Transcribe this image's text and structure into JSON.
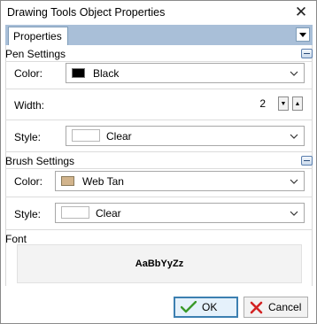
{
  "window": {
    "title": "Drawing Tools Object Properties"
  },
  "tabs": [
    {
      "label": "Properties"
    }
  ],
  "pen": {
    "header": "Pen Settings",
    "color_label": "Color:",
    "color_value": "Black",
    "color_swatch": "#000000",
    "width_label": "Width:",
    "width_value": "2",
    "style_label": "Style:",
    "style_value": "Clear"
  },
  "brush": {
    "header": "Brush Settings",
    "color_label": "Color:",
    "color_value": "Web Tan",
    "color_swatch": "#d2b48c",
    "style_label": "Style:",
    "style_value": "Clear"
  },
  "font": {
    "header": "Font",
    "preview": "AaBbYyZz"
  },
  "buttons": {
    "ok": "OK",
    "cancel": "Cancel"
  },
  "colors": {
    "tabstrip": "#a9bfd8",
    "ok_border": "#3c7fb1"
  }
}
